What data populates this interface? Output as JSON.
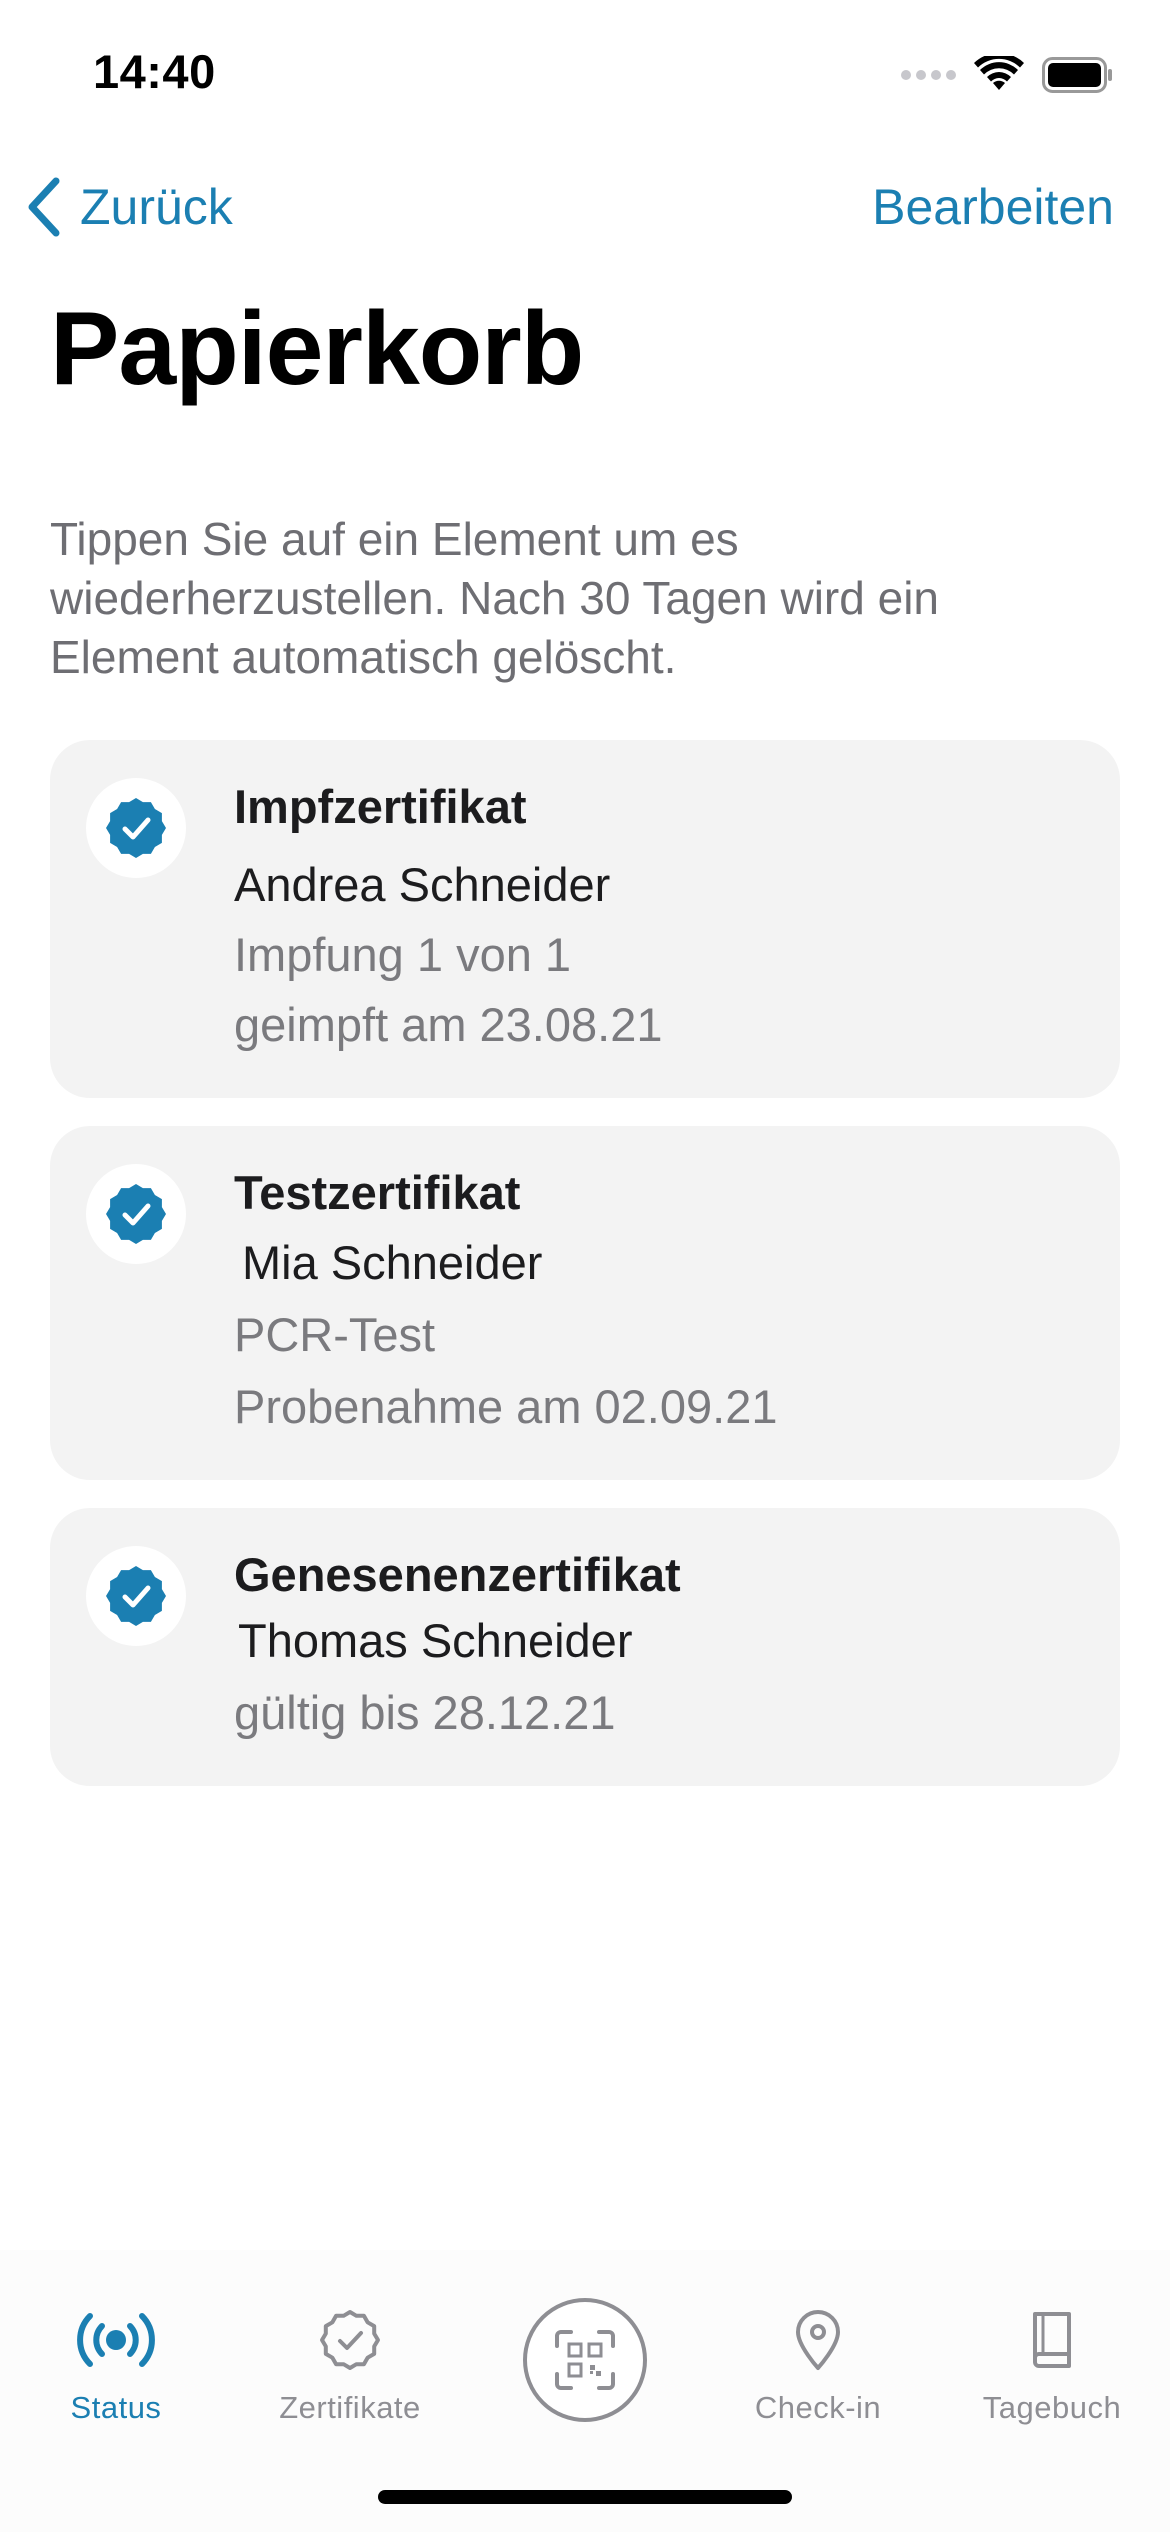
{
  "status_bar": {
    "time": "14:40"
  },
  "nav": {
    "back_label": "Zurück",
    "edit_label": "Bearbeiten"
  },
  "page": {
    "title": "Papierkorb",
    "description": "Tippen Sie auf ein Element um es wiederherzustellen. Nach 30 Tagen wird ein Element automatisch gelöscht."
  },
  "certificates": [
    {
      "type": "Impfzertifikat",
      "name": "Andrea Schneider",
      "details": [
        "Impfung 1 von 1",
        "geimpft am 23.08.21"
      ]
    },
    {
      "type": "Testzertifikat",
      "name": "Mia Schneider",
      "details": [
        "PCR-Test",
        "Probenahme am 02.09.21"
      ]
    },
    {
      "type": "Genesenenzertifikat",
      "name": "Thomas Schneider",
      "details": [
        "gültig bis 28.12.21"
      ]
    }
  ],
  "tab_bar": {
    "items": [
      {
        "label": "Status",
        "icon": "broadcast-icon",
        "active": true
      },
      {
        "label": "Zertifikate",
        "icon": "certificate-badge-icon",
        "active": false
      },
      {
        "label": "",
        "icon": "qr-scan-icon",
        "active": false
      },
      {
        "label": "Check-in",
        "icon": "location-pin-icon",
        "active": false
      },
      {
        "label": "Tagebuch",
        "icon": "book-icon",
        "active": false
      }
    ]
  },
  "colors": {
    "accent": "#1b7fb2",
    "badge": "#1b7fb2",
    "card_background": "#f3f3f3",
    "secondary_text": "#6e6e73"
  }
}
